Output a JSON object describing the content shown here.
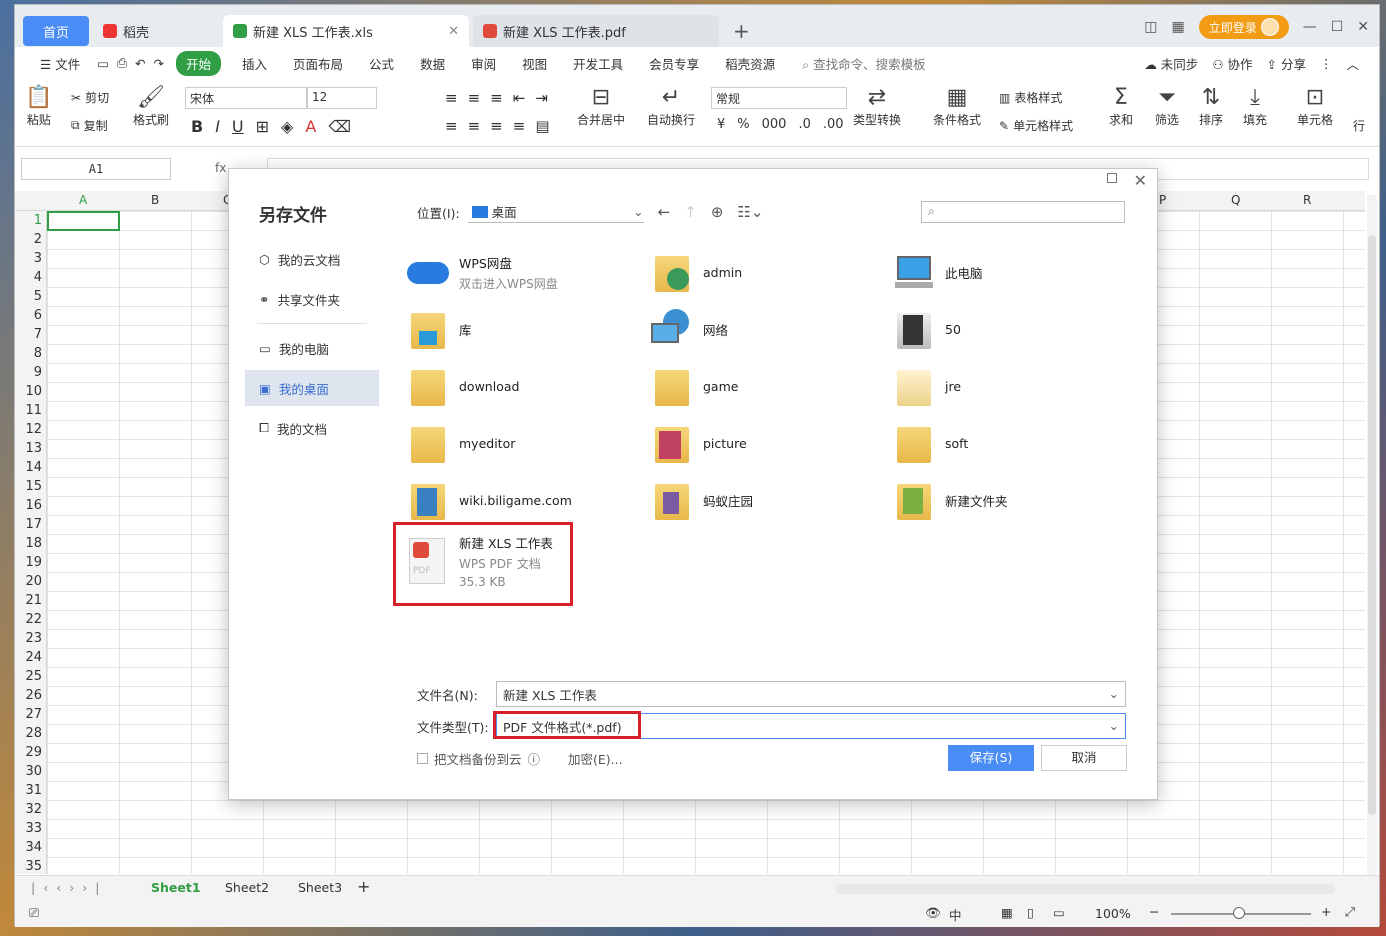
{
  "tabs": {
    "home": "首页",
    "daoke": "稻壳",
    "active": "新建 XLS 工作表.xls",
    "pdf": "新建 XLS 工作表.pdf",
    "login": "立即登录"
  },
  "menu": {
    "file": "文件",
    "start": "开始",
    "items": [
      "插入",
      "页面布局",
      "公式",
      "数据",
      "审阅",
      "视图",
      "开发工具",
      "会员专享",
      "稻壳资源"
    ],
    "search": "查找命令、搜索模板",
    "unsynced": "未同步",
    "collab": "协作",
    "share": "分享"
  },
  "ribbon": {
    "paste": "粘贴",
    "cut": "剪切",
    "copy": "复制",
    "format_painter": "格式刷",
    "font": "宋体",
    "size": "12",
    "merge": "合并居中",
    "wrap": "自动换行",
    "number_format": "常规",
    "type_convert": "类型转换",
    "cond_format": "条件格式",
    "table_style": "表格样式",
    "cell_style": "单元格样式",
    "sum": "求和",
    "filter": "筛选",
    "sort": "排序",
    "fill": "填充",
    "cell": "单元格",
    "more": "行"
  },
  "formula": {
    "namebox": "A1",
    "fx": "fx"
  },
  "columns": [
    "A",
    "B",
    "C",
    "P",
    "Q",
    "R"
  ],
  "rows": [
    "1",
    "2",
    "3",
    "4",
    "5",
    "6",
    "7",
    "8",
    "9",
    "10",
    "11",
    "12",
    "13",
    "14",
    "15",
    "16",
    "17",
    "18",
    "19",
    "20",
    "21",
    "22",
    "23",
    "24",
    "25",
    "26",
    "27",
    "28",
    "29",
    "30",
    "31",
    "32",
    "33",
    "34",
    "35"
  ],
  "sheets": [
    "Sheet1",
    "Sheet2",
    "Sheet3"
  ],
  "status": {
    "zoom": "100%"
  },
  "dialog": {
    "title": "另存文件",
    "sidebar": [
      "我的云文档",
      "共享文件夹",
      "我的电脑",
      "我的桌面",
      "我的文档"
    ],
    "location_label": "位置(I):",
    "location_value": "桌面",
    "files": [
      {
        "name": "WPS网盘",
        "sub": "双击进入WPS网盘"
      },
      {
        "name": "admin"
      },
      {
        "name": "此电脑"
      },
      {
        "name": "库"
      },
      {
        "name": "网络"
      },
      {
        "name": "50"
      },
      {
        "name": "download"
      },
      {
        "name": "game"
      },
      {
        "name": "jre"
      },
      {
        "name": "myeditor"
      },
      {
        "name": "picture"
      },
      {
        "name": "soft"
      },
      {
        "name": "wiki.biligame.com"
      },
      {
        "name": "蚂蚁庄园"
      },
      {
        "name": "新建文件夹"
      },
      {
        "name": "新建 XLS 工作表",
        "sub": "WPS PDF 文档",
        "size": "35.3 KB"
      }
    ],
    "filename_label": "文件名(N):",
    "filename_value": "新建 XLS 工作表",
    "filetype_label": "文件类型(T):",
    "filetype_value": "PDF 文件格式(*.pdf)",
    "backup": "把文档备份到云",
    "encrypt": "加密(E)...",
    "save": "保存(S)",
    "cancel": "取消"
  },
  "colors": {
    "accent": "#4a8cf5",
    "green": "#2f9e44",
    "highlight": "#d6202a"
  }
}
